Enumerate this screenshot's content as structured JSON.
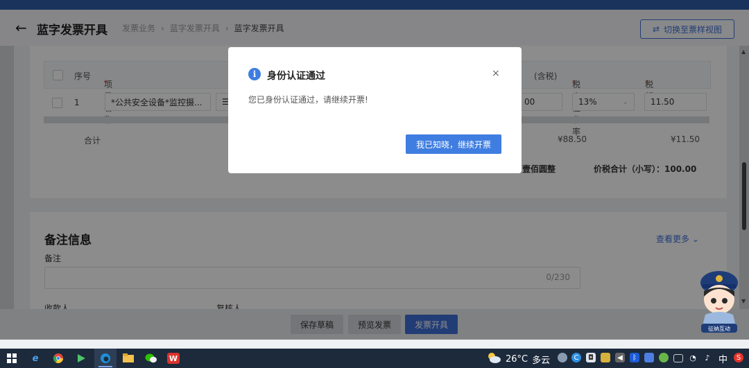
{
  "header": {
    "title": "蓝字发票开具",
    "breadcrumb": [
      "发票业务",
      "蓝字发票开具",
      "蓝字发票开具"
    ],
    "switch_button": "切换至票样视图"
  },
  "table": {
    "columns": {
      "index": "序号",
      "item_name": "项目名称",
      "amount_with_tax_tail": "(含税)",
      "tax_rate": "税率/征收率",
      "tax_amount": "税额"
    },
    "row": {
      "index": "1",
      "item_name": "*公共安全设备*监控摄...",
      "amount_tail": "00",
      "tax_rate": "13%",
      "tax_amount": "11.50"
    },
    "total_label": "合计",
    "total_amount": "¥88.50",
    "total_tax": "¥11.50",
    "uppercase_tail": "壹佰圆整",
    "sum_label": "价税合计（小写）：100.00"
  },
  "remark": {
    "section_title": "备注信息",
    "more_link": "查看更多",
    "label": "备注",
    "counter": "0/230",
    "payee_cut": "收款人",
    "reviewer_cut": "复核人"
  },
  "footer": {
    "save_draft": "保存草稿",
    "preview": "预览发票",
    "issue": "发票开具"
  },
  "modal": {
    "icon": "i",
    "title": "身份认证通过",
    "close": "×",
    "message": "您已身份认证通过，请继续开票!",
    "confirm_button": "我已知晓，继续开票"
  },
  "mascot": {
    "caption": "征纳互动"
  },
  "taskbar": {
    "weather": {
      "temp": "26°C",
      "desc": "多云"
    },
    "ime": "中",
    "apps": [
      "windows-icon",
      "ie-icon",
      "chrome-icon",
      "media-icon",
      "edge-icon",
      "folder-icon",
      "wechat-icon",
      "wps-icon"
    ]
  },
  "colors": {
    "accent": "#3f6fd8",
    "modal_button": "#3f7de0",
    "taskbar": "#1c2a3c",
    "top_strip": "#2f5ea8",
    "required": "#e04040"
  }
}
